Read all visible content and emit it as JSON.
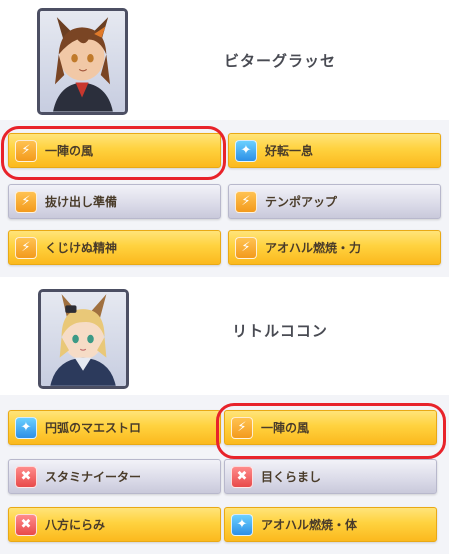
{
  "characters": [
    {
      "name": "ビターグラッセ",
      "skills": [
        {
          "label": "一陣の風",
          "rarity": "gold",
          "icon": "speed-icon",
          "icon_color": "orange",
          "glyph": "⚡"
        },
        {
          "label": "好転一息",
          "rarity": "gold",
          "icon": "recovery-icon",
          "icon_color": "blue",
          "glyph": "✦"
        },
        {
          "label": "抜け出し準備",
          "rarity": "silver",
          "icon": "speed-icon",
          "icon_color": "orange",
          "glyph": "⚡"
        },
        {
          "label": "テンポアップ",
          "rarity": "silver",
          "icon": "speed-icon",
          "icon_color": "orange",
          "glyph": "⚡"
        },
        {
          "label": "くじけぬ精神",
          "rarity": "gold",
          "icon": "speed-icon",
          "icon_color": "orange",
          "glyph": "⚡"
        },
        {
          "label": "アオハル燃焼・力",
          "rarity": "gold",
          "icon": "speed-icon",
          "icon_color": "orange",
          "glyph": "⚡"
        }
      ]
    },
    {
      "name": "リトルココン",
      "skills": [
        {
          "label": "円弧のマエストロ",
          "rarity": "gold",
          "icon": "recovery-icon",
          "icon_color": "blue",
          "glyph": "✦"
        },
        {
          "label": "一陣の風",
          "rarity": "gold",
          "icon": "speed-icon",
          "icon_color": "orange",
          "glyph": "⚡"
        },
        {
          "label": "スタミナイーター",
          "rarity": "silver",
          "icon": "debuff-icon",
          "icon_color": "red",
          "glyph": "✖"
        },
        {
          "label": "目くらまし",
          "rarity": "silver",
          "icon": "debuff-icon",
          "icon_color": "red",
          "glyph": "✖"
        },
        {
          "label": "八方にらみ",
          "rarity": "gold",
          "icon": "debuff-icon",
          "icon_color": "red",
          "glyph": "✖"
        },
        {
          "label": "アオハル燃焼・体",
          "rarity": "gold",
          "icon": "recovery-icon",
          "icon_color": "blue2",
          "glyph": "✦"
        }
      ]
    }
  ],
  "colors": {
    "gold": "#ffd23f",
    "silver": "#dcdce9",
    "highlight": "#e8232a",
    "name_text": "#494b53"
  }
}
